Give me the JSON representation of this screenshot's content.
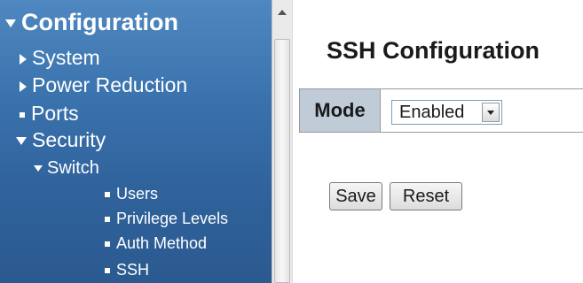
{
  "sidebar": {
    "items": [
      {
        "label": "Configuration",
        "icon": "triangle-down-icon",
        "level": 0
      },
      {
        "label": "System",
        "icon": "triangle-right-icon",
        "level": 1
      },
      {
        "label": "Power Reduction",
        "icon": "triangle-right-icon",
        "level": 1
      },
      {
        "label": "Ports",
        "icon": "square-bullet-icon",
        "level": 1
      },
      {
        "label": "Security",
        "icon": "triangle-down-icon",
        "level": 1
      },
      {
        "label": "Switch",
        "icon": "triangle-down-icon",
        "level": 2
      },
      {
        "label": "Users",
        "icon": "square-bullet-icon",
        "level": 3
      },
      {
        "label": "Privilege Levels",
        "icon": "square-bullet-icon",
        "level": 3
      },
      {
        "label": "Auth Method",
        "icon": "square-bullet-icon",
        "level": 3
      },
      {
        "label": "SSH",
        "icon": "square-bullet-icon",
        "level": 3
      }
    ]
  },
  "main": {
    "title": "SSH Configuration",
    "mode_label": "Mode",
    "mode_value": "Enabled",
    "save_label": "Save",
    "reset_label": "Reset"
  },
  "colors": {
    "sidebar_bg": "#3a72ad",
    "table_header_bg": "#bfcbd7"
  }
}
